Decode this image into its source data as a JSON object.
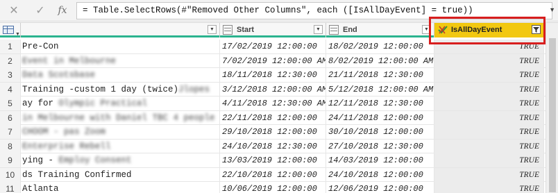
{
  "formula_bar": {
    "cancel_icon": "✕",
    "confirm_icon": "✓",
    "fx_label": "fx",
    "formula": "= Table.SelectRows(#\"Removed Other Columns\", each ([IsAllDayEvent] = true))",
    "expand_icon": "▼"
  },
  "columns": {
    "start": "Start",
    "end": "End",
    "flag": "IsAllDayEvent",
    "dropdown_glyph": "▼",
    "filter_glyph": "▼"
  },
  "rows": [
    {
      "num": "1",
      "name": " Pre-Con",
      "name_blur": "",
      "start": "17/02/2019 12:00:00",
      "end": "18/02/2019 12:00:00",
      "flag": "TRUE"
    },
    {
      "num": "2",
      "name": "",
      "name_blur": "Event in Melbourne",
      "start": "7/02/2019 12:00:00 AM",
      "end": "8/02/2019 12:00:00 AM",
      "flag": "TRUE"
    },
    {
      "num": "3",
      "name": "",
      "name_blur": "Data Scotsbase",
      "start": "18/11/2018 12:30:00",
      "end": "21/11/2018 12:30:00",
      "flag": "TRUE"
    },
    {
      "num": "4",
      "name": " Training -custom 1 day (twice)",
      "name_blur": "Jlopes",
      "start": "3/12/2018 12:00:00 AM",
      "end": "5/12/2018 12:00:00 AM",
      "flag": "TRUE"
    },
    {
      "num": "5",
      "name": "ay for ",
      "name_blur": "Olympic Practical",
      "start": "4/11/2018 12:30:00 AM",
      "end": "12/11/2018 12:30:00",
      "flag": "TRUE"
    },
    {
      "num": "6",
      "name": "",
      "name_blur": " in Melbourne with Daniel TBC 4 people",
      "start": "22/11/2018 12:00:00",
      "end": "24/11/2018 12:00:00",
      "flag": "TRUE"
    },
    {
      "num": "7",
      "name": "",
      "name_blur": " CHOOM - pas Zoom",
      "start": "29/10/2018 12:00:00",
      "end": "30/10/2018 12:00:00",
      "flag": "TRUE"
    },
    {
      "num": "8",
      "name": "",
      "name_blur": "Enterprise Rebell",
      "start": "24/10/2018 12:30:00",
      "end": "27/10/2018 12:30:00",
      "flag": "TRUE"
    },
    {
      "num": "9",
      "name": "ying - ",
      "name_blur": "Employ Consent",
      "start": "13/03/2019 12:00:00",
      "end": "14/03/2019 12:00:00",
      "flag": "TRUE"
    },
    {
      "num": "10",
      "name": "ds Training Confirmed",
      "name_blur": "",
      "start": "22/10/2018 12:00:00",
      "end": "24/10/2018 12:00:00",
      "flag": "TRUE"
    },
    {
      "num": "11",
      "name": "Atlanta",
      "name_blur": "",
      "start": "10/06/2019 12:00:00",
      "end": "12/06/2019 12:00:00",
      "flag": "TRUE"
    }
  ]
}
